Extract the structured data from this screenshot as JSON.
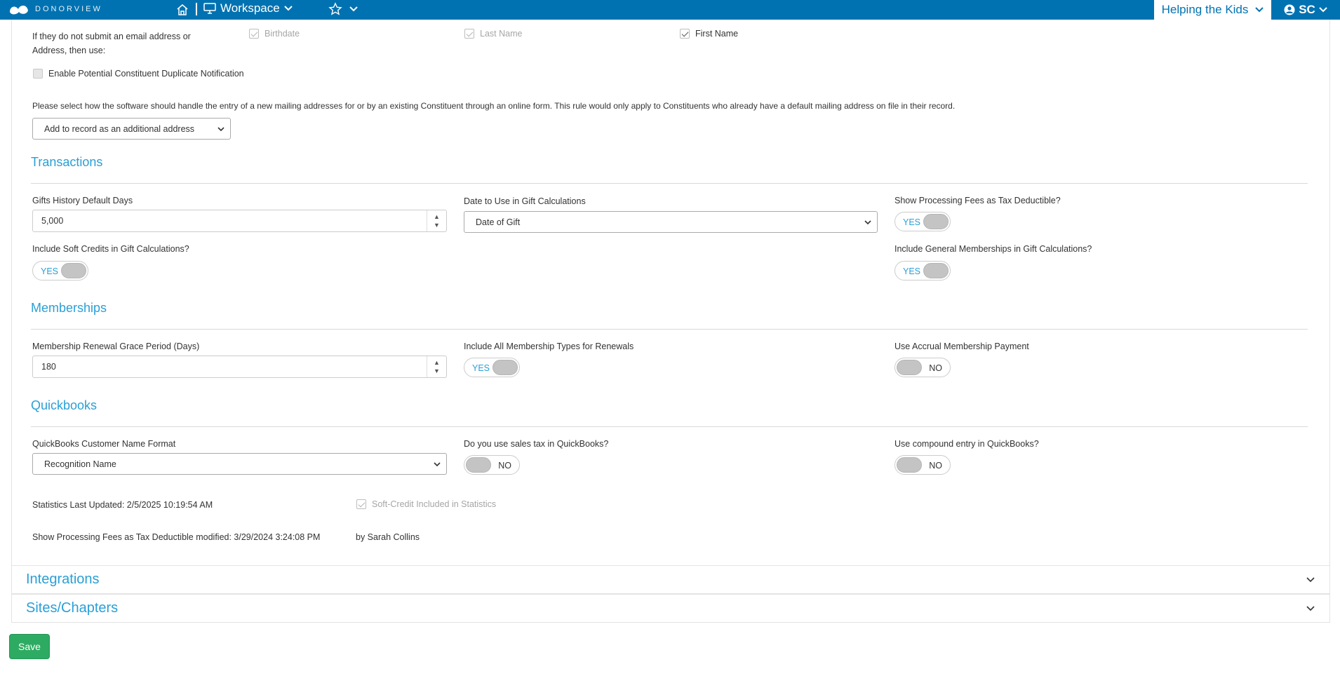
{
  "topbar": {
    "logo_text": "DONORVIEW",
    "workspace_label": "Workspace",
    "org_label": "Helping the Kids",
    "user_initials": "SC"
  },
  "constituent": {
    "fallback_label_line1": "If they do not submit an email address or",
    "fallback_label_line2": "Address, then use:",
    "fallback_options": [
      {
        "label": "Birthdate",
        "checked": true,
        "disabled": true
      },
      {
        "label": "Last Name",
        "checked": true,
        "disabled": true
      },
      {
        "label": "First Name",
        "checked": true,
        "disabled": false
      }
    ],
    "duplicate_notification_label": "Enable Potential Constituent Duplicate Notification",
    "duplicate_notification_checked": false,
    "address_rule_text": "Please select how the software should handle the entry of a new mailing addresses for or by an existing Constituent through an online form. This rule would only apply to Constituents who already have a default mailing address on file in their record.",
    "address_rule_value": "Add to record as an additional address"
  },
  "transactions": {
    "title": "Transactions",
    "gifts_history_label": "Gifts History Default Days",
    "gifts_history_value": "5,000",
    "date_calc_label": "Date to Use in Gift Calculations",
    "date_calc_value": "Date of Gift",
    "fees_tax_label": "Show Processing Fees as Tax Deductible?",
    "fees_tax_value": "YES",
    "soft_credits_label": "Include Soft Credits in Gift Calculations?",
    "soft_credits_value": "YES",
    "general_memberships_label": "Include General Memberships in Gift Calculations?",
    "general_memberships_value": "YES"
  },
  "memberships": {
    "title": "Memberships",
    "grace_period_label": "Membership Renewal Grace Period (Days)",
    "grace_period_value": "180",
    "all_types_label": "Include All Membership Types for Renewals",
    "all_types_value": "YES",
    "accrual_label": "Use Accrual Membership Payment",
    "accrual_value": "NO"
  },
  "quickbooks": {
    "title": "Quickbooks",
    "name_format_label": "QuickBooks Customer Name Format",
    "name_format_value": "Recognition Name",
    "sales_tax_label": "Do you use sales tax in QuickBooks?",
    "sales_tax_value": "NO",
    "compound_label": "Use compound entry in QuickBooks?",
    "compound_value": "NO"
  },
  "footer_info": {
    "stats_updated": "Statistics Last Updated: 2/5/2025 10:19:54 AM",
    "soft_credit_stats_label": "Soft-Credit Included in Statistics",
    "fees_modified": "Show Processing Fees as Tax Deductible modified: 3/29/2024 3:24:08 PM",
    "modified_by": "by Sarah Collins"
  },
  "accordion": {
    "integrations": "Integrations",
    "sites": "Sites/Chapters"
  },
  "save_label": "Save",
  "colors": {
    "topbar": "#0172b1",
    "accent": "#2a9fd6",
    "save": "#2eab62"
  }
}
